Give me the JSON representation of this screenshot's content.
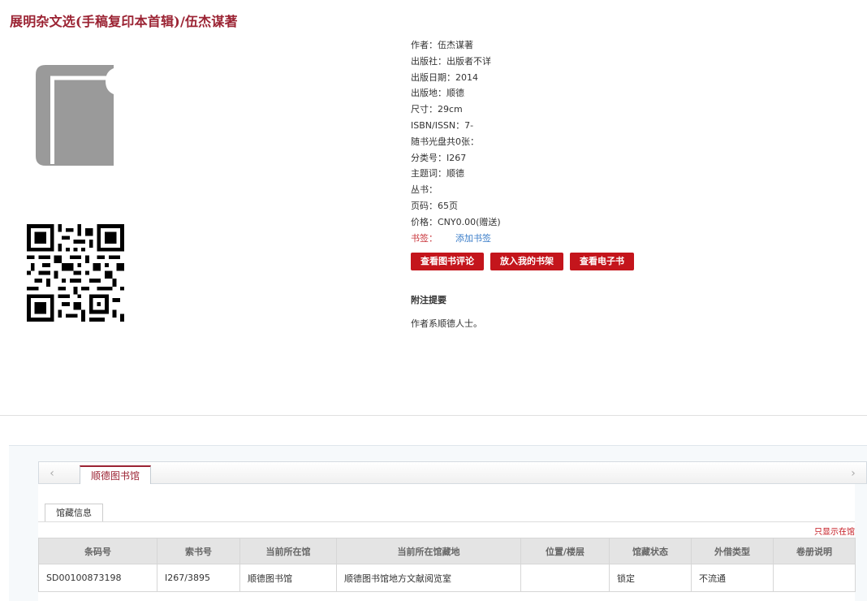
{
  "book": {
    "title": "展明杂文选(手稿复印本首辑)/伍杰谋著"
  },
  "meta": [
    "作者：伍杰谋著",
    "出版社：出版者不详",
    "出版日期：2014",
    "出版地：顺德",
    "尺寸：29cm",
    "ISBN/ISSN：7-",
    "随书光盘共0张：",
    "分类号：I267",
    "主题词：顺德",
    "丛书：",
    "页码：65页",
    "价格：CNY0.00(赠送)"
  ],
  "bookmark": {
    "label": "书签：",
    "link": "添加书签"
  },
  "buttons": {
    "review": "查看图书评论",
    "shelf": "放入我的书架",
    "ebook": "查看电子书"
  },
  "notes": {
    "title": "附注提要",
    "text": "作者系顺德人士。"
  },
  "holdings": {
    "library_tab": "顺德图书馆",
    "info_tab": "馆藏信息",
    "only_show": "只显示在馆",
    "columns": [
      "条码号",
      "索书号",
      "当前所在馆",
      "当前所在馆藏地",
      "位置/楼层",
      "馆藏状态",
      "外借类型",
      "卷册说明"
    ],
    "rows": [
      [
        "SD00100873198",
        "I267/3895",
        "顺德图书馆",
        "顺德图书馆地方文献阅览室",
        "",
        "锁定",
        "不流通",
        ""
      ]
    ]
  },
  "icons": {
    "cover": "book-icon",
    "qr": "qr-code",
    "left": "chevron-left-icon",
    "right": "chevron-right-icon"
  },
  "colors": {
    "title": "#9b2333",
    "button": "#c4151c",
    "link": "#3a7dc9"
  }
}
